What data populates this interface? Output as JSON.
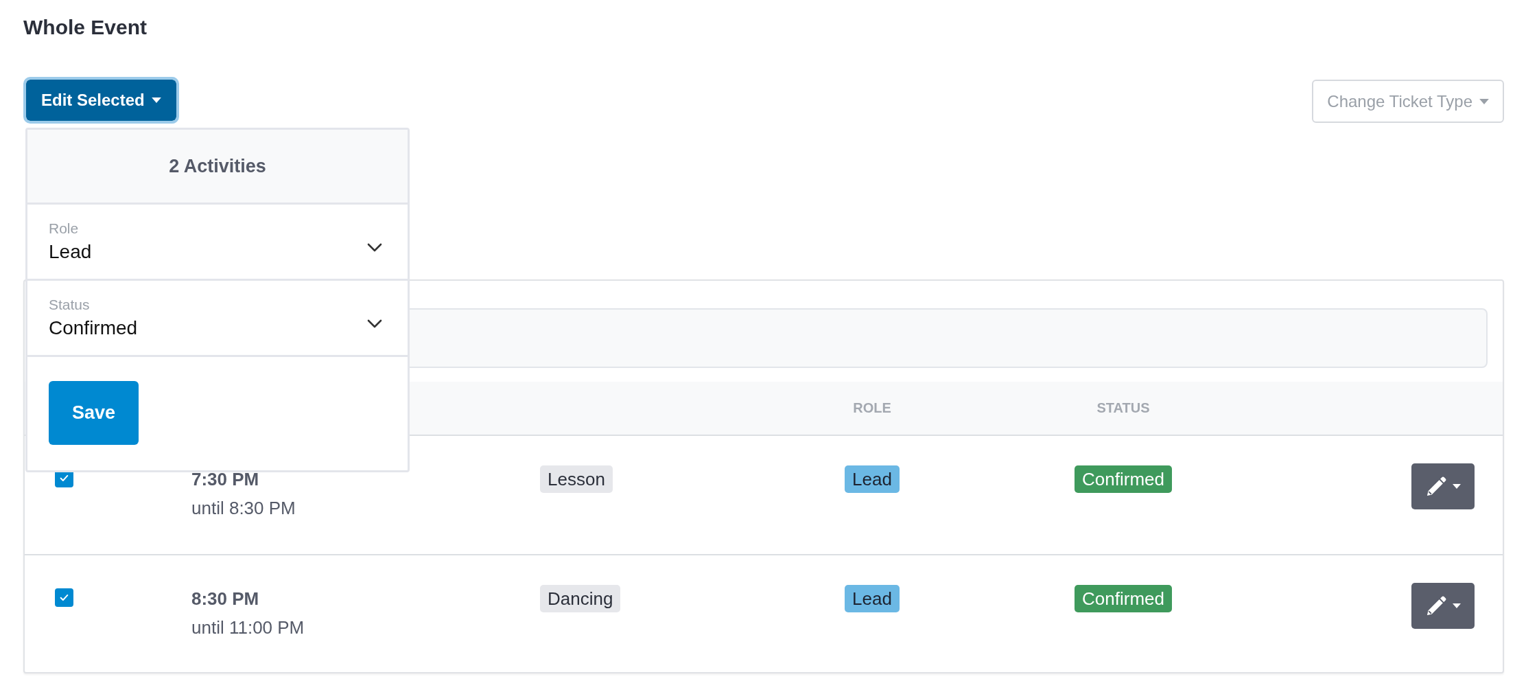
{
  "page": {
    "title": "Whole Event"
  },
  "toolbar": {
    "edit_selected": {
      "label": "Edit Selected",
      "expanded": true
    },
    "change_ticket_type": {
      "label": "Change Ticket Type",
      "disabled": true
    }
  },
  "edit_menu": {
    "title": "2 Activities",
    "fields": [
      {
        "label": "Role",
        "value": "Lead"
      },
      {
        "label": "Status",
        "value": "Confirmed"
      }
    ],
    "save_button": "Save"
  },
  "table": {
    "columns": {
      "role": "ROLE",
      "status": "STATUS"
    },
    "rows": [
      {
        "checked": true,
        "start": "7:30 PM",
        "end": "until 8:30 PM",
        "activity": "Lesson",
        "role": "Lead",
        "status": "Confirmed"
      },
      {
        "checked": true,
        "start": "8:30 PM",
        "end": "until 11:00 PM",
        "activity": "Dancing",
        "role": "Lead",
        "status": "Confirmed"
      }
    ]
  }
}
